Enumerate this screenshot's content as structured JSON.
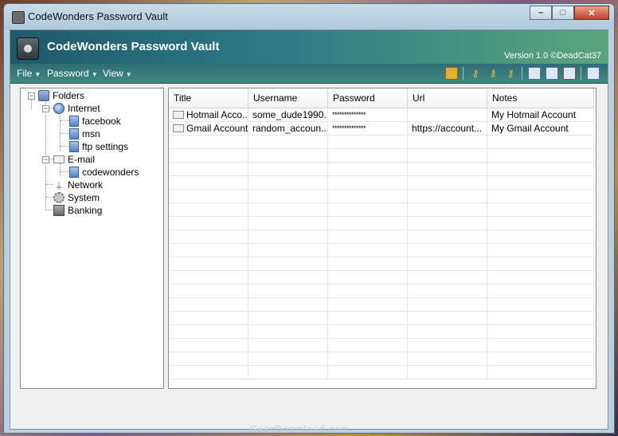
{
  "window": {
    "title": "CodeWonders Password Vault",
    "minimize": "–",
    "maximize": "□",
    "close": "✕"
  },
  "banner": {
    "title": "CodeWonders Password Vault",
    "version": "Version 1.0 ©DeadCat37"
  },
  "menu": {
    "file": "File",
    "password": "Password",
    "view": "View"
  },
  "toolbar": {
    "icons": [
      "lock-icon",
      "key-add-icon",
      "key-edit-icon",
      "key-delete-icon",
      "record-add-icon",
      "record-copy-icon",
      "record-delete-icon",
      "export-icon"
    ]
  },
  "tree": {
    "root": "Folders",
    "internet": "Internet",
    "facebook": "facebook",
    "msn": "msn",
    "ftp": "ftp settings",
    "email": "E-mail",
    "codewonders": "codewonders",
    "network": "Network",
    "system": "System",
    "banking": "Banking"
  },
  "grid": {
    "columns": [
      "Title",
      "Username",
      "Password",
      "Url",
      "Notes"
    ],
    "rows": [
      {
        "title": "Hotmail Acco...",
        "username": "some_dude1990...",
        "password": "**************",
        "url": "",
        "notes": "My Hotmail Account"
      },
      {
        "title": "Gmail Account",
        "username": "random_accoun...",
        "password": "**************",
        "url": "https://account...",
        "notes": "My Gmail Account"
      }
    ]
  },
  "watermark": "GearDownload.com"
}
